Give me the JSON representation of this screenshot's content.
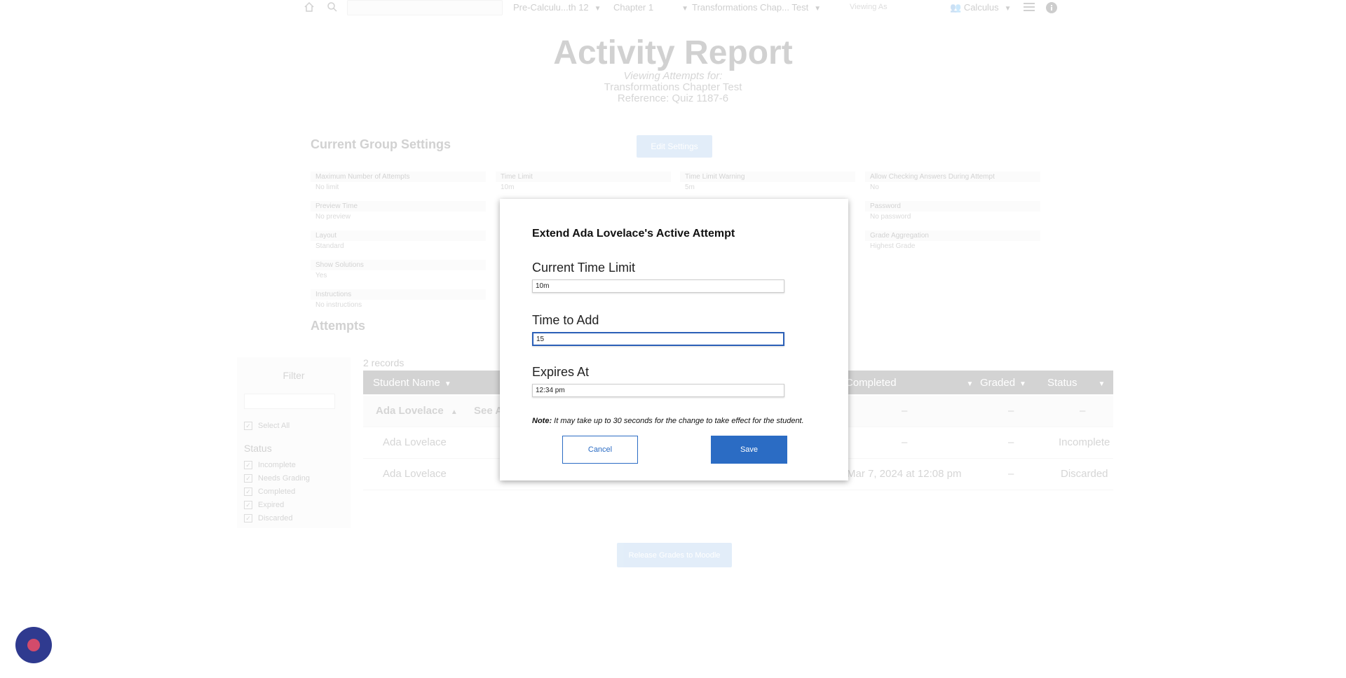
{
  "topbar": {
    "course": "Pre-Calculu...th 12",
    "chapter": "Chapter 1",
    "assignment": "Transformations Chap... Test",
    "viewing": "Viewing As",
    "class": "Calculus"
  },
  "report": {
    "title": "Activity Report",
    "viewing_label": "Viewing Attempts for:",
    "assignment_name": "Transformations Chapter Test",
    "reference": "Reference: Quiz 1187-6"
  },
  "settings": {
    "heading": "Current Group Settings",
    "edit_button": "Edit Settings",
    "items": [
      {
        "label": "Maximum Number of Attempts",
        "value": "No limit"
      },
      {
        "label": "Time Limit",
        "value": "10m"
      },
      {
        "label": "Time Limit Warning",
        "value": "5m"
      },
      {
        "label": "Allow Checking Answers During Attempt",
        "value": "No"
      },
      {
        "label": "Preview Time",
        "value": "No preview"
      },
      {
        "label": "Password",
        "value": "No password"
      },
      {
        "label": "Layout",
        "value": "Standard"
      },
      {
        "label": "Grade Aggregation",
        "value": "Highest Grade"
      },
      {
        "label": "Show Solutions",
        "value": "Yes"
      },
      {
        "label": "Instructions",
        "value": "No instructions"
      }
    ]
  },
  "attempts": {
    "heading": "Attempts",
    "records": "2 records",
    "filter": {
      "title": "Filter",
      "select_all": "Select All",
      "status_heading": "Status",
      "options": [
        "Incomplete",
        "Needs Grading",
        "Completed",
        "Expired",
        "Discarded"
      ]
    },
    "columns": [
      "Student Name",
      "Completed",
      "Graded",
      "Status"
    ],
    "summary_row": {
      "name": "Ada Lovelace",
      "see_all": "See A",
      "completed": "–",
      "graded": "–",
      "status": "–"
    },
    "rows": [
      {
        "name": "Ada Lovelace",
        "completed": "–",
        "graded": "–",
        "status": "Incomplete"
      },
      {
        "name": "Ada Lovelace",
        "completed": "Mar 7, 2024 at 12:08 pm",
        "graded": "–",
        "status": "Discarded"
      }
    ],
    "release_button": "Release Grades to Moodle"
  },
  "modal": {
    "title": "Extend Ada Lovelace's Active Attempt",
    "current_limit_label": "Current Time Limit",
    "current_limit_value": "10m",
    "time_to_add_label": "Time to Add",
    "time_to_add_value": "15",
    "expires_label": "Expires At",
    "expires_value": "12:34 pm",
    "note_label": "Note:",
    "note_text": "It may take up to 30 seconds for the change to take effect for the student.",
    "cancel": "Cancel",
    "save": "Save"
  },
  "colors": {
    "accent": "#2b6cc4",
    "focus": "#2b5fb7",
    "table_header": "#3a3a3a",
    "chat_bubble": "#2f3a8f"
  }
}
